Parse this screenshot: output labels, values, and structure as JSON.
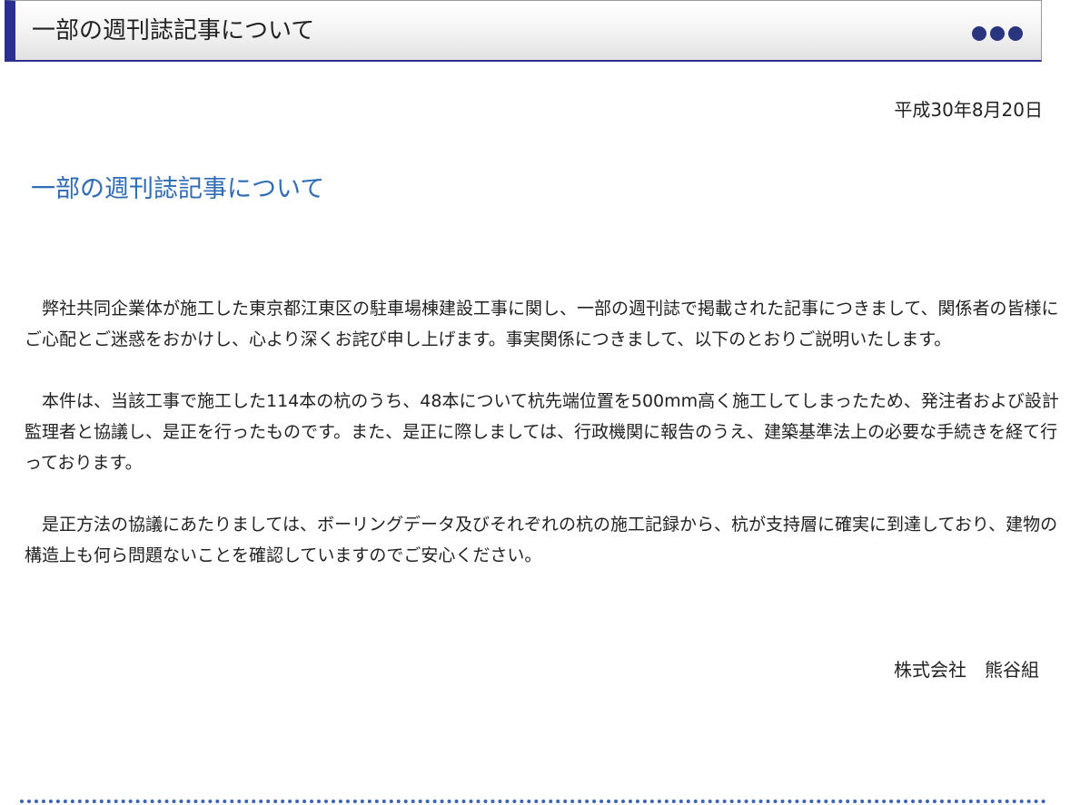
{
  "header": {
    "title": "一部の週刊誌記事について",
    "more_icon": "three-dots-icon",
    "accent_color": "#2b2f8f"
  },
  "date": "平成30年8月20日",
  "article": {
    "title": "一部の週刊誌記事について",
    "title_color": "#2f6cb4",
    "paragraphs": [
      "弊社共同企業体が施工した東京都江東区の駐車場棟建設工事に関し、一部の週刊誌で掲載された記事につきまして、関係者の皆様にご心配とご迷惑をおかけし、心より深くお詫び申し上げます。事実関係につきまして、以下のとおりご説明いたします。",
      "本件は、当該工事で施工した114本の杭のうち、48本について杭先端位置を500mm高く施工してしまったため、発注者および設計監理者と協議し、是正を行ったものです。また、是正に際しましては、行政機関に報告のうえ、建築基準法上の必要な手続きを経て行っております。",
      "是正方法の協議にあたりましては、ボーリングデータ及びそれぞれの杭の施工記録から、杭が支持層に確実に到達しており、建物の構造上も何ら問題ないことを確認していますのでご安心ください。"
    ]
  },
  "company": "株式会社　熊谷組",
  "divider_color": "#3b64b4"
}
